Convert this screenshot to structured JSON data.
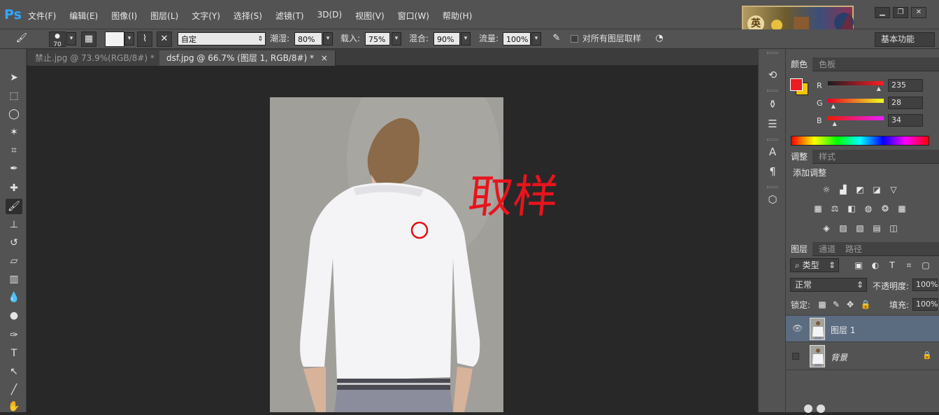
{
  "app": {
    "logo": "Ps"
  },
  "menu": [
    "文件(F)",
    "编辑(E)",
    "图像(I)",
    "图层(L)",
    "文字(Y)",
    "选择(S)",
    "滤镜(T)",
    "3D(D)",
    "视图(V)",
    "窗口(W)",
    "帮助(H)"
  ],
  "window_buttons": {
    "minimize": "▁",
    "restore": "❐",
    "close": "✕"
  },
  "banner_text": "英",
  "options": {
    "brush_size": "70",
    "mode": "自定",
    "wetness_label": "潮湿:",
    "wetness": "80%",
    "load_label": "载入:",
    "load": "75%",
    "mix_label": "混合:",
    "mix": "90%",
    "flow_label": "流量:",
    "flow": "100%",
    "sample_all_label": "对所有图层取样",
    "workspace": "基本功能"
  },
  "tabs": [
    {
      "label": "禁止.jpg @ 73.9%(RGB/8#) *",
      "close": "×"
    },
    {
      "label": "dsf.jpg @ 66.7% (图层 1, RGB/8#) *",
      "close": "×"
    }
  ],
  "canvas_annotation": "取样",
  "color_panel": {
    "tabs": [
      "颜色",
      "色板"
    ],
    "r_label": "R",
    "r": "235",
    "g_label": "G",
    "g": "28",
    "b_label": "B",
    "b": "34",
    "foreground": "#eb1c22",
    "background": "#f5c400"
  },
  "adjust_panel": {
    "tabs": [
      "调整",
      "样式"
    ],
    "title": "添加调整"
  },
  "layers_panel": {
    "tabs": [
      "图层",
      "通道",
      "路径"
    ],
    "filter": "类型",
    "blend_mode": "正常",
    "opacity_label": "不透明度:",
    "opacity": "100%",
    "lock_label": "锁定:",
    "fill_label": "填充:",
    "fill": "100%",
    "layers": [
      {
        "name": "图层 1",
        "visible": true,
        "selected": true
      },
      {
        "name": "背景",
        "visible": false,
        "locked": true
      }
    ]
  }
}
